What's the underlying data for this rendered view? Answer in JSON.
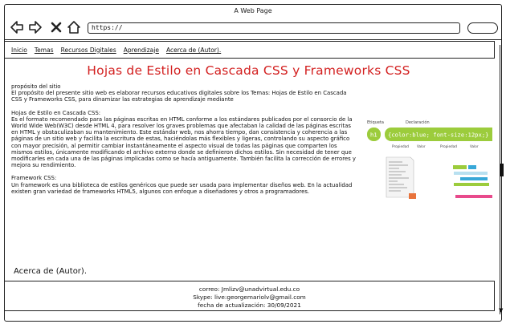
{
  "window": {
    "title": "A Web Page"
  },
  "toolbar": {
    "url": "https://"
  },
  "menu": [
    {
      "label": "Inicio"
    },
    {
      "label": "Temas"
    },
    {
      "label": "Recursos Digitales"
    },
    {
      "label": "Aprendizaje"
    },
    {
      "label": "Acerca de (Autor)."
    }
  ],
  "main": {
    "title": "Hojas de Estilo en Cascada CSS y Frameworks CSS",
    "sections": [
      {
        "heading": "propósito del sitio",
        "body": "El propósito del presente sitio web es elaborar recursos educativos digitales sobre los Temas: Hojas de Estilo en Cascada CSS y Frameworks CSS, para dinamizar las estrategias de aprendizaje mediante"
      },
      {
        "heading": "Hojas de Estilo en Cascada CSS:",
        "body": "Es el formato recomendado para las páginas escritas en HTML conforme a los estándares publicados por el consorcio de la World Wide Web(W3C) desde HTML 4, para resolver los graves problemas que afectaban la calidad de las páginas escritas en HTML y obstaculizaban su mantenimiento. Este estándar web, nos ahorra tiempo, dan consistencia y coherencia a las páginas de un sitio web y facilita la escritura de estas, haciéndolas más flexibles y ligeras, controlando su aspecto gráfico con mayor precisión, al permitir cambiar instantáneamente el aspecto visual de todas las páginas que comparten los mismos estilos, únicamente modificando el archivo externo donde se definieron dichos estilos. Sin necesidad de tener que modificarles en cada una de las páginas implicadas como se hacía antiguamente. También facilita la corrección de errores y mejora su rendimiento."
      },
      {
        "heading": "Framework CSS:",
        "body": "Un framework es una biblioteca de estilos genéricos que puede ser usada para implementar diseños web. En la actualidad existen gran variedad de frameworks HTML5, algunos con enfoque a diseñadores y otros a programadores."
      }
    ],
    "author_link": "Acerca de (Autor)."
  },
  "illustration": {
    "label_etiqueta": "Etiqueta",
    "label_declaracion": "Declaración",
    "tag": "h1",
    "rule": "{color:blue; font-size:12px;}",
    "label_propiedad": "Propiedad",
    "label_valor": "Valor",
    "colors": {
      "green": "#9ccc3c",
      "dark": "#333333",
      "orange": "#e8733c",
      "pink": "#e84a8c",
      "blue": "#38a8d8"
    }
  },
  "footer": {
    "line1": "correo: Jmlizv@unadvirtual.edu.co",
    "line2": "Skype: live:georgemariolv@gmail.com",
    "line3": "fecha de actualización: 30/09/2021"
  }
}
